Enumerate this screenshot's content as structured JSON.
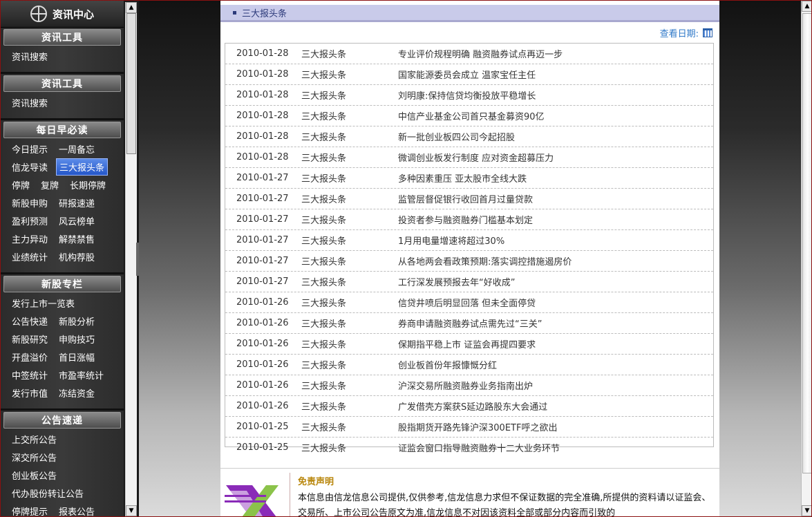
{
  "sidebar": {
    "header": "资讯中心",
    "sections": [
      {
        "title": "资讯工具",
        "rows": [
          [
            "资讯搜索"
          ]
        ]
      },
      {
        "title": "资讯工具",
        "rows": [
          [
            "资讯搜索"
          ]
        ]
      },
      {
        "title": "每日早必读",
        "rows": [
          [
            "今日提示",
            "一周备忘"
          ],
          [
            "信龙导读",
            "三大报头条"
          ],
          [
            "停牌",
            "复牌",
            "长期停牌"
          ],
          [
            "新股申购",
            "研报速递"
          ],
          [
            "盈利预测",
            "风云榜单"
          ],
          [
            "主力异动",
            "解禁禁售"
          ],
          [
            "业绩统计",
            "机构荐股"
          ]
        ]
      },
      {
        "title": "新股专栏",
        "rows": [
          [
            "发行上市一览表"
          ],
          [
            "公告快递",
            "新股分析"
          ],
          [
            "新股研究",
            "申购技巧"
          ],
          [
            "开盘溢价",
            "首日涨幅"
          ],
          [
            "中签统计",
            "市盈率统计"
          ],
          [
            "发行市值",
            "冻结资金"
          ]
        ]
      },
      {
        "title": "公告速递",
        "rows": [
          [
            "上交所公告"
          ],
          [
            "深交所公告"
          ],
          [
            "创业板公告"
          ],
          [
            "代办股份转让公告"
          ],
          [
            "停牌提示",
            "报表公告"
          ]
        ]
      }
    ],
    "active_item": "三大报头条"
  },
  "main": {
    "section_title": "三大报头条",
    "date_label": "查看日期:",
    "news": [
      {
        "date": "2010-01-28",
        "category": "三大报头条",
        "title": "专业评价规程明确 融资融券试点再迈一步"
      },
      {
        "date": "2010-01-28",
        "category": "三大报头条",
        "title": "国家能源委员会成立 温家宝任主任"
      },
      {
        "date": "2010-01-28",
        "category": "三大报头条",
        "title": "刘明康:保持信贷均衡投放平稳增长"
      },
      {
        "date": "2010-01-28",
        "category": "三大报头条",
        "title": "中信产业基金公司首只基金募资90亿"
      },
      {
        "date": "2010-01-28",
        "category": "三大报头条",
        "title": "新一批创业板四公司今起招股"
      },
      {
        "date": "2010-01-28",
        "category": "三大报头条",
        "title": "微调创业板发行制度 应对资金超募压力"
      },
      {
        "date": "2010-01-27",
        "category": "三大报头条",
        "title": "多种因素重压 亚太股市全线大跌"
      },
      {
        "date": "2010-01-27",
        "category": "三大报头条",
        "title": "监管层督促银行收回首月过量贷款"
      },
      {
        "date": "2010-01-27",
        "category": "三大报头条",
        "title": "投资者参与融资融券门槛基本划定"
      },
      {
        "date": "2010-01-27",
        "category": "三大报头条",
        "title": "1月用电量增速将超过30%"
      },
      {
        "date": "2010-01-27",
        "category": "三大报头条",
        "title": "从各地两会看政策预期:落实调控措施遏房价"
      },
      {
        "date": "2010-01-27",
        "category": "三大报头条",
        "title": "工行深发展预报去年“好收成”"
      },
      {
        "date": "2010-01-26",
        "category": "三大报头条",
        "title": "信贷井喷后明显回落 但未全面停贷"
      },
      {
        "date": "2010-01-26",
        "category": "三大报头条",
        "title": "券商申请融资融券试点需先过“三关”"
      },
      {
        "date": "2010-01-26",
        "category": "三大报头条",
        "title": "保期指平稳上市 证监会再提四要求"
      },
      {
        "date": "2010-01-26",
        "category": "三大报头条",
        "title": "创业板首份年报慷慨分红"
      },
      {
        "date": "2010-01-26",
        "category": "三大报头条",
        "title": "沪深交易所融资融券业务指南出炉"
      },
      {
        "date": "2010-01-26",
        "category": "三大报头条",
        "title": "广发借壳方案获S延边路股东大会通过"
      },
      {
        "date": "2010-01-25",
        "category": "三大报头条",
        "title": "股指期货开路先锋沪深300ETF呼之欲出"
      },
      {
        "date": "2010-01-25",
        "category": "三大报头条",
        "title": "证监会窗口指导融资融券十二大业务环节"
      }
    ],
    "disclaimer_title": "免责声明",
    "disclaimer_text": "本信息由信龙信息公司提供,仅供参考,信龙信息力求但不保证数据的完全准确,所提供的资料请以证监会、交易所、上市公司公告原文为准,信龙信息不对因该资料全部或部分内容而引致的"
  }
}
